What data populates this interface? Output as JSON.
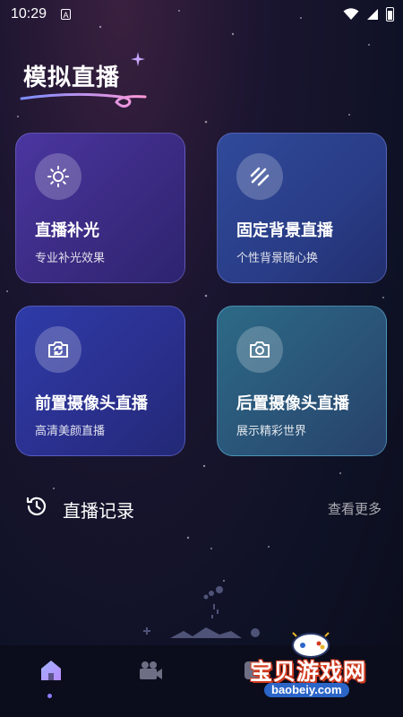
{
  "status_bar": {
    "time": "10:29",
    "notif_icon_letter": "A"
  },
  "header": {
    "title": "模拟直播"
  },
  "cards": [
    {
      "title": "直播补光",
      "subtitle": "专业补光效果",
      "icon": "sun-icon"
    },
    {
      "title": "固定背景直播",
      "subtitle": "个性背景随心换",
      "icon": "stripes-icon"
    },
    {
      "title": "前置摄像头直播",
      "subtitle": "高清美颜直播",
      "icon": "switch-camera-icon"
    },
    {
      "title": "后置摄像头直播",
      "subtitle": "展示精彩世界",
      "icon": "camera-icon"
    }
  ],
  "history": {
    "title": "直播记录",
    "more": "查看更多"
  },
  "bottom_nav": [
    {
      "name": "home",
      "icon": "home-icon",
      "active": true
    },
    {
      "name": "live",
      "icon": "video-camera-icon",
      "active": false
    },
    {
      "name": "other",
      "icon": "third-icon",
      "active": false
    }
  ],
  "watermark": {
    "text": "宝贝游戏网",
    "url": "baobeiy.com"
  },
  "colors": {
    "accent": "#8a7dff",
    "background": "#0f1226"
  }
}
